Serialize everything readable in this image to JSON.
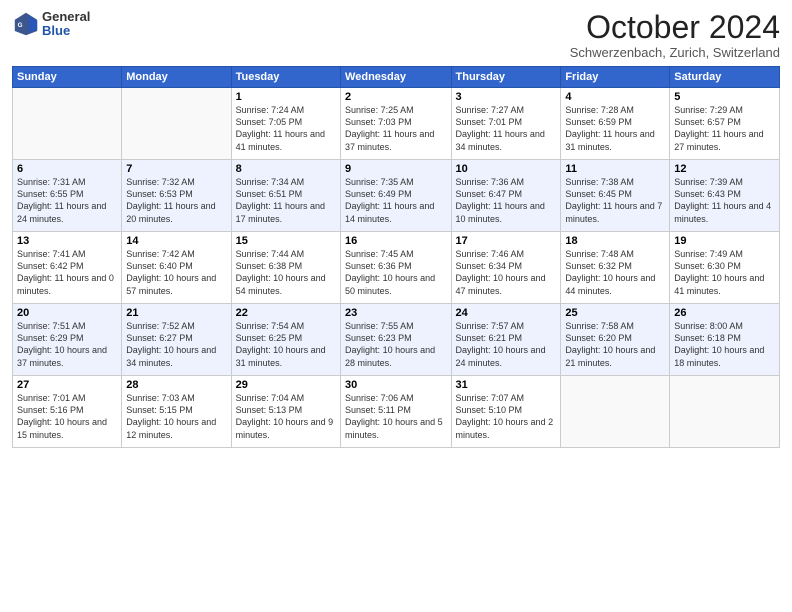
{
  "header": {
    "logo": {
      "general": "General",
      "blue": "Blue"
    },
    "title": "October 2024",
    "location": "Schwerzenbach, Zurich, Switzerland"
  },
  "weekdays": [
    "Sunday",
    "Monday",
    "Tuesday",
    "Wednesday",
    "Thursday",
    "Friday",
    "Saturday"
  ],
  "weeks": [
    [
      {
        "day": "",
        "info": ""
      },
      {
        "day": "",
        "info": ""
      },
      {
        "day": "1",
        "info": "Sunrise: 7:24 AM\nSunset: 7:05 PM\nDaylight: 11 hours and 41 minutes."
      },
      {
        "day": "2",
        "info": "Sunrise: 7:25 AM\nSunset: 7:03 PM\nDaylight: 11 hours and 37 minutes."
      },
      {
        "day": "3",
        "info": "Sunrise: 7:27 AM\nSunset: 7:01 PM\nDaylight: 11 hours and 34 minutes."
      },
      {
        "day": "4",
        "info": "Sunrise: 7:28 AM\nSunset: 6:59 PM\nDaylight: 11 hours and 31 minutes."
      },
      {
        "day": "5",
        "info": "Sunrise: 7:29 AM\nSunset: 6:57 PM\nDaylight: 11 hours and 27 minutes."
      }
    ],
    [
      {
        "day": "6",
        "info": "Sunrise: 7:31 AM\nSunset: 6:55 PM\nDaylight: 11 hours and 24 minutes."
      },
      {
        "day": "7",
        "info": "Sunrise: 7:32 AM\nSunset: 6:53 PM\nDaylight: 11 hours and 20 minutes."
      },
      {
        "day": "8",
        "info": "Sunrise: 7:34 AM\nSunset: 6:51 PM\nDaylight: 11 hours and 17 minutes."
      },
      {
        "day": "9",
        "info": "Sunrise: 7:35 AM\nSunset: 6:49 PM\nDaylight: 11 hours and 14 minutes."
      },
      {
        "day": "10",
        "info": "Sunrise: 7:36 AM\nSunset: 6:47 PM\nDaylight: 11 hours and 10 minutes."
      },
      {
        "day": "11",
        "info": "Sunrise: 7:38 AM\nSunset: 6:45 PM\nDaylight: 11 hours and 7 minutes."
      },
      {
        "day": "12",
        "info": "Sunrise: 7:39 AM\nSunset: 6:43 PM\nDaylight: 11 hours and 4 minutes."
      }
    ],
    [
      {
        "day": "13",
        "info": "Sunrise: 7:41 AM\nSunset: 6:42 PM\nDaylight: 11 hours and 0 minutes."
      },
      {
        "day": "14",
        "info": "Sunrise: 7:42 AM\nSunset: 6:40 PM\nDaylight: 10 hours and 57 minutes."
      },
      {
        "day": "15",
        "info": "Sunrise: 7:44 AM\nSunset: 6:38 PM\nDaylight: 10 hours and 54 minutes."
      },
      {
        "day": "16",
        "info": "Sunrise: 7:45 AM\nSunset: 6:36 PM\nDaylight: 10 hours and 50 minutes."
      },
      {
        "day": "17",
        "info": "Sunrise: 7:46 AM\nSunset: 6:34 PM\nDaylight: 10 hours and 47 minutes."
      },
      {
        "day": "18",
        "info": "Sunrise: 7:48 AM\nSunset: 6:32 PM\nDaylight: 10 hours and 44 minutes."
      },
      {
        "day": "19",
        "info": "Sunrise: 7:49 AM\nSunset: 6:30 PM\nDaylight: 10 hours and 41 minutes."
      }
    ],
    [
      {
        "day": "20",
        "info": "Sunrise: 7:51 AM\nSunset: 6:29 PM\nDaylight: 10 hours and 37 minutes."
      },
      {
        "day": "21",
        "info": "Sunrise: 7:52 AM\nSunset: 6:27 PM\nDaylight: 10 hours and 34 minutes."
      },
      {
        "day": "22",
        "info": "Sunrise: 7:54 AM\nSunset: 6:25 PM\nDaylight: 10 hours and 31 minutes."
      },
      {
        "day": "23",
        "info": "Sunrise: 7:55 AM\nSunset: 6:23 PM\nDaylight: 10 hours and 28 minutes."
      },
      {
        "day": "24",
        "info": "Sunrise: 7:57 AM\nSunset: 6:21 PM\nDaylight: 10 hours and 24 minutes."
      },
      {
        "day": "25",
        "info": "Sunrise: 7:58 AM\nSunset: 6:20 PM\nDaylight: 10 hours and 21 minutes."
      },
      {
        "day": "26",
        "info": "Sunrise: 8:00 AM\nSunset: 6:18 PM\nDaylight: 10 hours and 18 minutes."
      }
    ],
    [
      {
        "day": "27",
        "info": "Sunrise: 7:01 AM\nSunset: 5:16 PM\nDaylight: 10 hours and 15 minutes."
      },
      {
        "day": "28",
        "info": "Sunrise: 7:03 AM\nSunset: 5:15 PM\nDaylight: 10 hours and 12 minutes."
      },
      {
        "day": "29",
        "info": "Sunrise: 7:04 AM\nSunset: 5:13 PM\nDaylight: 10 hours and 9 minutes."
      },
      {
        "day": "30",
        "info": "Sunrise: 7:06 AM\nSunset: 5:11 PM\nDaylight: 10 hours and 5 minutes."
      },
      {
        "day": "31",
        "info": "Sunrise: 7:07 AM\nSunset: 5:10 PM\nDaylight: 10 hours and 2 minutes."
      },
      {
        "day": "",
        "info": ""
      },
      {
        "day": "",
        "info": ""
      }
    ]
  ]
}
